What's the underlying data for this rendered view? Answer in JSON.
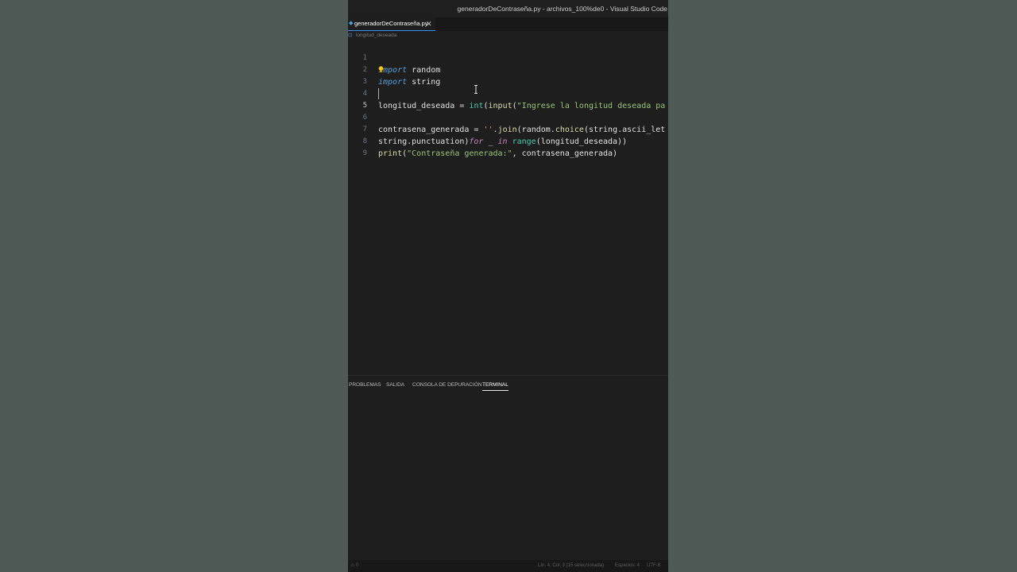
{
  "window": {
    "title": "generadorDeContraseña.py - archivos_100%de0 - Visual Studio Code"
  },
  "tab": {
    "filename": "generadorDeContraseña.py",
    "close_glyph": "✕",
    "icon": "python-file-icon"
  },
  "breadcrumb": {
    "symbol": "longitud_deseada",
    "icon": "variable-symbol-icon"
  },
  "editor": {
    "language": "python",
    "lines": [
      {
        "number": "1",
        "text": "import random"
      },
      {
        "number": "2",
        "text": "import string"
      },
      {
        "number": "3",
        "text": ""
      },
      {
        "number": "4",
        "text": "longitud_deseada = int(input(\"Ingrese la longitud deseada pa"
      },
      {
        "number": "5",
        "text": ""
      },
      {
        "number": "6",
        "text": "contrasena_generada = ''.join(random.choice(string.ascii_let"
      },
      {
        "number": "7",
        "text": "string.punctuation)for _ in range(longitud_deseada))"
      },
      {
        "number": "8",
        "text": "print(\"Contraseña generada:\", contrasena_generada)"
      },
      {
        "number": "9",
        "text": ""
      }
    ],
    "active_line": "5",
    "colors": {
      "keyword": "#569cd6",
      "control": "#c586c0",
      "function": "#dcdcaa",
      "string": "#ce9178",
      "background": "#1e1e1e"
    }
  },
  "panel": {
    "tabs": [
      {
        "label": "PROBLEMAS"
      },
      {
        "label": "SALIDA"
      },
      {
        "label": "CONSOLA DE DEPURACIÓN"
      },
      {
        "label": "TERMINAL"
      }
    ],
    "active_tab": "TERMINAL"
  },
  "statusbar": {
    "problems": "⚠ 0",
    "position": "Lín. 4, Col. 3 (15 seleccionada)",
    "indent": "Espacios: 4",
    "encoding": "UTF-8"
  }
}
